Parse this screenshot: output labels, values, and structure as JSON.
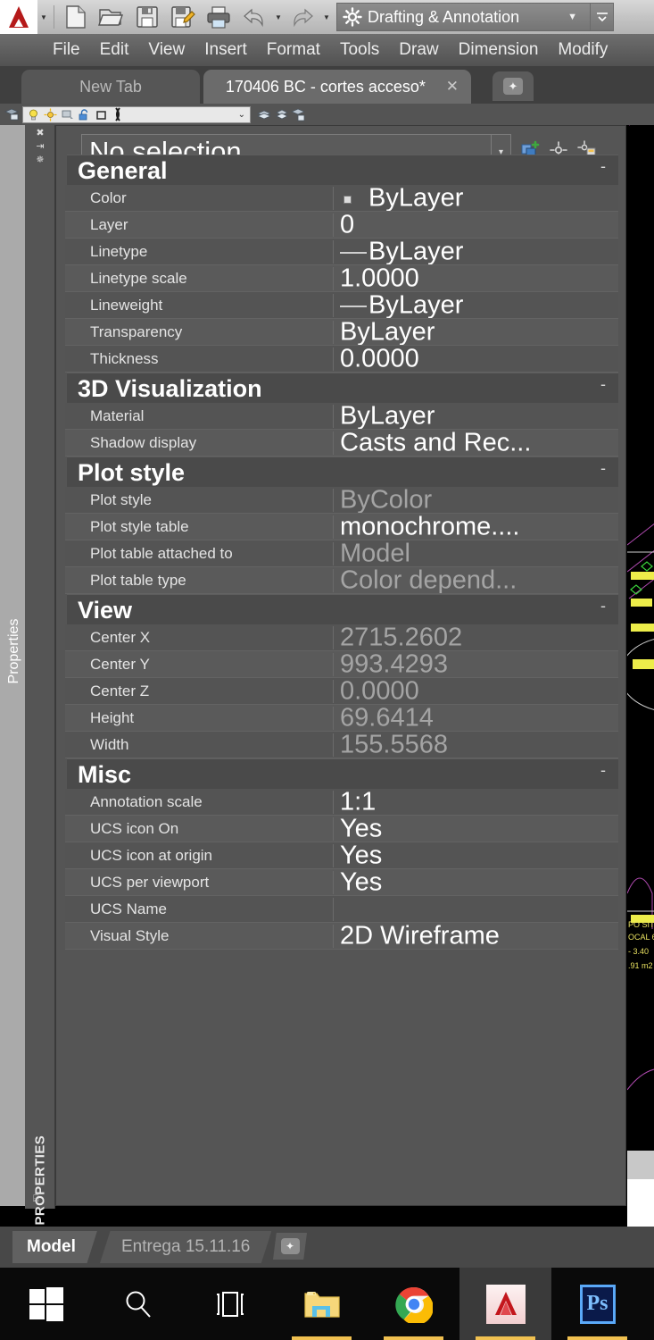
{
  "quick_access": {
    "app_icon": "autocad-logo-icon",
    "buttons": [
      {
        "name": "new-file-button",
        "icon": "new-document-icon"
      },
      {
        "name": "open-file-button",
        "icon": "open-folder-icon"
      },
      {
        "name": "save-button",
        "icon": "floppy-save-icon"
      },
      {
        "name": "save-as-button",
        "icon": "floppy-save-as-icon"
      },
      {
        "name": "plot-button",
        "icon": "printer-icon"
      },
      {
        "name": "undo-button",
        "icon": "undo-arrow-icon"
      },
      {
        "name": "undo-dropdown",
        "icon": "caret-down-icon"
      },
      {
        "name": "redo-button",
        "icon": "redo-arrow-icon"
      },
      {
        "name": "redo-dropdown",
        "icon": "caret-down-icon"
      }
    ],
    "workspace": "Drafting & Annotation",
    "workspace_icon": "gear-icon",
    "workspace_arrow": "▼",
    "more_icon": "☰"
  },
  "menubar": {
    "items": [
      "File",
      "Edit",
      "View",
      "Insert",
      "Format",
      "Tools",
      "Draw",
      "Dimension",
      "Modify"
    ]
  },
  "tabs": {
    "new_tab": "New Tab",
    "active_tab": "170406 BC - cortes acceso*",
    "close_glyph": "✕",
    "add_glyph": "✦"
  },
  "layer_toolbar": {
    "icons": [
      "layer-properties-icon",
      "lightbulb-on-icon",
      "sun-freeze-icon",
      "freeze-viewport-icon",
      "unlock-icon",
      "plot-style-square-icon",
      "layer-zero-icon"
    ],
    "layer_value": "",
    "combo_arrow": "⌄",
    "right_icons": [
      "layer-previous-icon",
      "layer-isolate-icon",
      "layer-states-icon"
    ]
  },
  "properties_panel": {
    "tooltip_label": "Properties",
    "vertical_label": "PROPERTIES",
    "strip_icons": [
      "close-icon",
      "auto-hide-icon",
      "panel-options-icon"
    ],
    "strip_mini_icon": "resize-grip-icon",
    "selection": "No selection",
    "selection_dropdown": "▾",
    "header_icons": [
      "select-objects-icon",
      "quick-select-icon",
      "quick-calc-icon"
    ],
    "minimize_glyph": "-",
    "groups": [
      {
        "title": "General",
        "rows": [
          {
            "label": "Color",
            "value": "ByLayer",
            "dim": false,
            "icon": "color-swatch"
          },
          {
            "label": "Layer",
            "value": "0",
            "dim": false,
            "icon": "none"
          },
          {
            "label": "Linetype",
            "value": "ByLayer",
            "dim": false,
            "icon": "line-sample"
          },
          {
            "label": "Linetype scale",
            "value": "1.0000",
            "dim": false,
            "icon": "none"
          },
          {
            "label": "Lineweight",
            "value": "ByLayer",
            "dim": false,
            "icon": "line-sample"
          },
          {
            "label": "Transparency",
            "value": "ByLayer",
            "dim": false,
            "icon": "none"
          },
          {
            "label": "Thickness",
            "value": "0.0000",
            "dim": false,
            "icon": "none"
          }
        ]
      },
      {
        "title": "3D Visualization",
        "rows": [
          {
            "label": "Material",
            "value": "ByLayer",
            "dim": false,
            "icon": "none"
          },
          {
            "label": "Shadow display",
            "value": "Casts and Rec...",
            "dim": false,
            "icon": "none"
          }
        ]
      },
      {
        "title": "Plot style",
        "rows": [
          {
            "label": "Plot style",
            "value": "ByColor",
            "dim": true,
            "icon": "none"
          },
          {
            "label": "Plot style table",
            "value": "monochrome....",
            "dim": false,
            "icon": "none"
          },
          {
            "label": "Plot table attached to",
            "value": "Model",
            "dim": true,
            "icon": "none"
          },
          {
            "label": "Plot table type",
            "value": "Color  depend...",
            "dim": true,
            "icon": "none"
          }
        ]
      },
      {
        "title": "View",
        "rows": [
          {
            "label": "Center X",
            "value": "2715.2602",
            "dim": true,
            "icon": "none"
          },
          {
            "label": "Center Y",
            "value": "993.4293",
            "dim": true,
            "icon": "none"
          },
          {
            "label": "Center Z",
            "value": "0.0000",
            "dim": true,
            "icon": "none"
          },
          {
            "label": "Height",
            "value": "69.6414",
            "dim": true,
            "icon": "none"
          },
          {
            "label": "Width",
            "value": "155.5568",
            "dim": true,
            "icon": "none"
          }
        ]
      },
      {
        "title": "Misc",
        "rows": [
          {
            "label": "Annotation scale",
            "value": "1:1",
            "dim": false,
            "icon": "none"
          },
          {
            "label": "UCS icon On",
            "value": "Yes",
            "dim": false,
            "icon": "none"
          },
          {
            "label": "UCS icon at origin",
            "value": "Yes",
            "dim": false,
            "icon": "none"
          },
          {
            "label": "UCS per viewport",
            "value": "Yes",
            "dim": false,
            "icon": "none"
          },
          {
            "label": "UCS Name",
            "value": "",
            "dim": false,
            "icon": "none"
          },
          {
            "label": "Visual Style",
            "value": "2D Wireframe",
            "dim": false,
            "icon": "none"
          }
        ]
      }
    ]
  },
  "drawing": {
    "labels": [
      "PO SITO",
      "OCAL 6",
      "- 3.40",
      ".91 m2"
    ]
  },
  "model_tabs": {
    "model": "Model",
    "layout": "Entrega 15.11.16",
    "add_glyph": "✦"
  },
  "taskbar": {
    "items": [
      {
        "name": "start-button",
        "icon": "windows-logo-icon",
        "active": false,
        "running": false
      },
      {
        "name": "search-button",
        "icon": "search-icon",
        "active": false,
        "running": false
      },
      {
        "name": "task-view-button",
        "icon": "task-view-icon",
        "active": false,
        "running": false
      },
      {
        "name": "file-explorer-button",
        "icon": "folder-icon",
        "active": false,
        "running": true
      },
      {
        "name": "chrome-button",
        "icon": "chrome-icon",
        "active": false,
        "running": true
      },
      {
        "name": "autocad-button",
        "icon": "autocad-logo-icon",
        "active": true,
        "running": true
      },
      {
        "name": "photoshop-button",
        "icon": "photoshop-icon",
        "active": false,
        "running": true
      }
    ],
    "photoshop_label": "Ps"
  }
}
